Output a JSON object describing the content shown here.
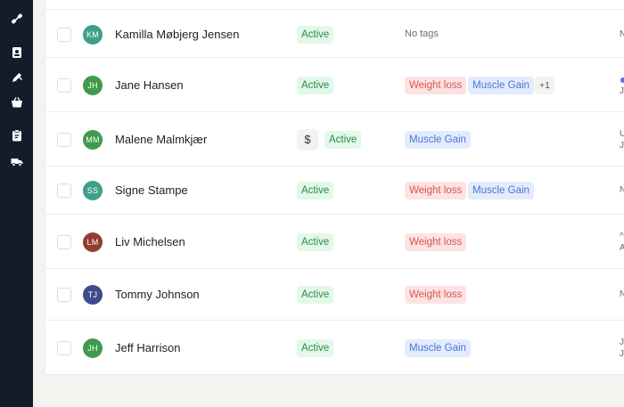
{
  "sidebar": {
    "icons": [
      "link-icon",
      "contact-book-icon",
      "pencil-icon",
      "basket-icon",
      "clipboard-icon",
      "truck-icon"
    ]
  },
  "clients": [
    {
      "initials": "KM",
      "name": "Kamilla Møbjerg Jensen",
      "avatar_color": "#3f9f8a",
      "status": "Active",
      "paid": false,
      "no_tags_text": "No tags",
      "tags": [],
      "more": "",
      "edge_top": "N",
      "edge_bottom": ""
    },
    {
      "initials": "JH",
      "name": "Jane Hansen",
      "avatar_color": "#3f9a4a",
      "status": "Active",
      "paid": false,
      "no_tags_text": "",
      "tags": [
        "Weight loss",
        "Muscle Gain"
      ],
      "more": "+1",
      "edge_top": "",
      "edge_bottom": "J"
    },
    {
      "initials": "MM",
      "name": "Malene Malmkjær",
      "avatar_color": "#3f9a4a",
      "status": "Active",
      "paid": true,
      "dollar": "$",
      "no_tags_text": "",
      "tags": [
        "Muscle Gain"
      ],
      "more": "",
      "edge_top": "U",
      "edge_bottom": "J"
    },
    {
      "initials": "SS",
      "name": "Signe Stampe",
      "avatar_color": "#3f9f8a",
      "status": "Active",
      "paid": false,
      "no_tags_text": "",
      "tags": [
        "Weight loss",
        "Muscle Gain"
      ],
      "more": "",
      "edge_top": "N",
      "edge_bottom": ""
    },
    {
      "initials": "LM",
      "name": "Liv Michelsen",
      "avatar_color": "#8f3e2f",
      "status": "Active",
      "paid": false,
      "no_tags_text": "",
      "tags": [
        "Weight loss"
      ],
      "more": "",
      "edge_top": "^",
      "edge_bottom": "A"
    },
    {
      "initials": "TJ",
      "name": "Tommy Johnson",
      "avatar_color": "#3d4a8c",
      "status": "Active",
      "paid": false,
      "no_tags_text": "",
      "tags": [
        "Weight loss"
      ],
      "more": "",
      "edge_top": "N",
      "edge_bottom": ""
    },
    {
      "initials": "JH",
      "name": "Jeff Harrison",
      "avatar_color": "#3f9a4a",
      "status": "Active",
      "paid": false,
      "no_tags_text": "",
      "tags": [
        "Muscle Gain"
      ],
      "more": "",
      "edge_top": "J",
      "edge_bottom": "J"
    }
  ]
}
